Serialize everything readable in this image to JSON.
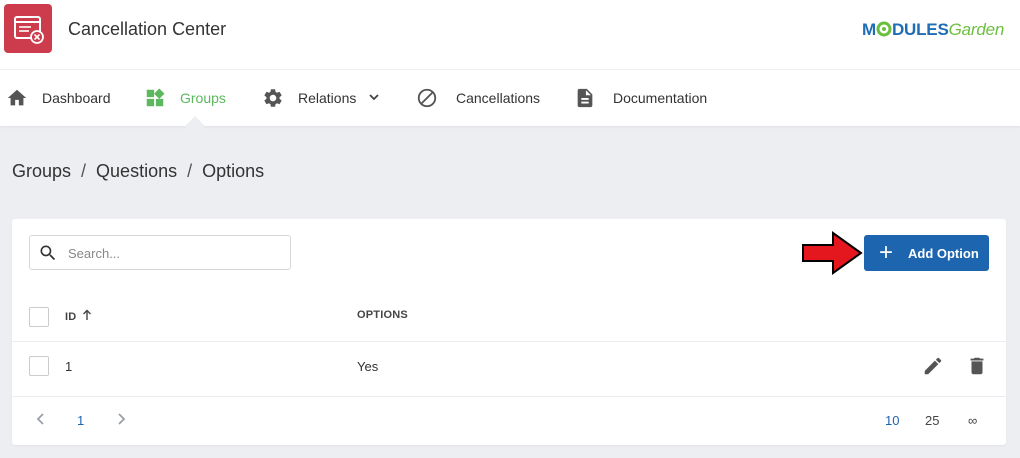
{
  "app": {
    "title": "Cancellation Center",
    "icon": "cancellation-center-icon"
  },
  "logo": {
    "part1": "M",
    "part2": "DULES",
    "part3": "Garden",
    "brand_colors": [
      "#1f6db5",
      "#6cbf3e"
    ]
  },
  "nav": {
    "items": [
      {
        "label": "Dashboard",
        "icon": "home-icon",
        "active": false
      },
      {
        "label": "Groups",
        "icon": "widgets-icon",
        "active": true
      },
      {
        "label": "Relations",
        "icon": "gear-icon",
        "active": false,
        "has_dropdown": true
      },
      {
        "label": "Cancellations",
        "icon": "block-icon",
        "active": false
      },
      {
        "label": "Documentation",
        "icon": "document-icon",
        "active": false
      }
    ],
    "active_color": "#5cb85c"
  },
  "breadcrumb": [
    "Groups",
    "Questions",
    "Options"
  ],
  "breadcrumb_sep": "/",
  "search": {
    "placeholder": "Search...",
    "value": ""
  },
  "toolbar": {
    "add_label": "Add Option",
    "accent": "#1e65b0",
    "annotation": "red-arrow"
  },
  "table": {
    "columns": [
      {
        "label": "ID",
        "sort": "ascending"
      },
      {
        "label": "OPTIONS"
      }
    ],
    "rows": [
      {
        "id": "1",
        "option": "Yes",
        "actions": [
          "edit-icon",
          "delete-icon"
        ]
      }
    ]
  },
  "pagination": {
    "current_page": "1",
    "page_sizes": [
      "10",
      "25",
      "∞"
    ],
    "selected_size": "10"
  }
}
